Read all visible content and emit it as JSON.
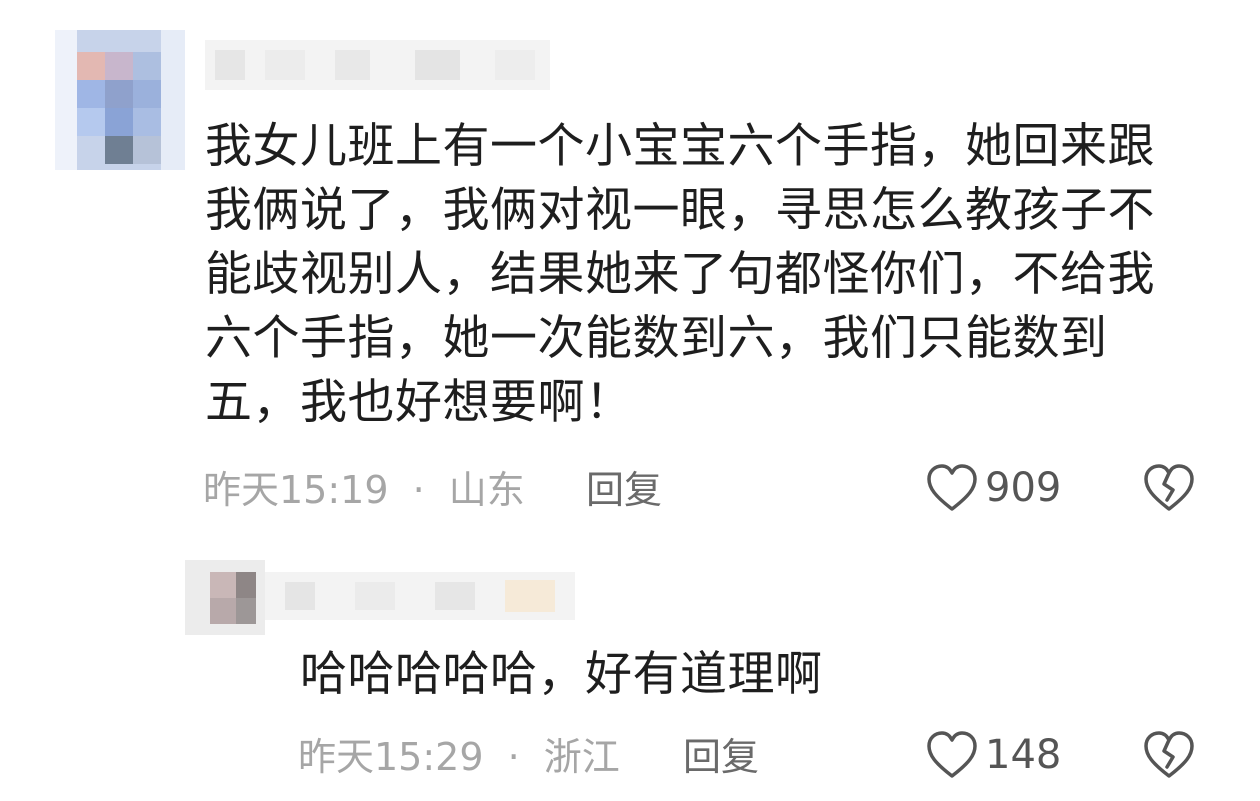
{
  "comments": [
    {
      "text": "我女儿班上有一个小宝宝六个手指，她回来跟\n我俩说了，我俩对视一眼，寻思怎么教孩子不\n能歧视别人，结果她来了句都怪你们，不给我\n六个手指，她一次能数到六，我们只能数到\n五，我也好想要啊！",
      "time": "昨天15:19",
      "separator": "·",
      "location": "山东",
      "reply_label": "回复",
      "likes": "909"
    },
    {
      "text": "哈哈哈哈哈，好有道理啊",
      "time": "昨天15:29",
      "separator": "·",
      "location": "浙江",
      "reply_label": "回复",
      "likes": "148"
    }
  ],
  "icons": {
    "like": "heart-outline-icon",
    "dislike": "broken-heart-icon"
  },
  "colors": {
    "text": "#1e1e1e",
    "meta": "#a6a6a6",
    "reply": "#6a6a6a",
    "icon": "#555555"
  }
}
